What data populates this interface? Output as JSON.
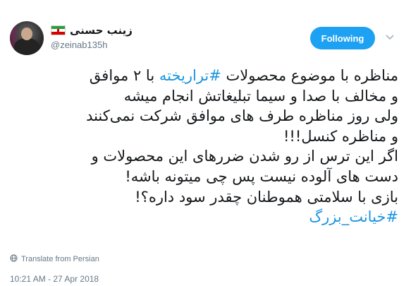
{
  "tweet": {
    "display_name": "زینب حسنی",
    "handle": "@zeinab135h",
    "follow_label": "Following",
    "lines": [
      {
        "parts": [
          {
            "text": "مناظره با موضوع محصولات ",
            "hashtag": false
          },
          {
            "text": "#تراریخته",
            "hashtag": true
          },
          {
            "text": " با ۲ موافق",
            "hashtag": false
          }
        ]
      },
      {
        "parts": [
          {
            "text": "و مخالف با صدا و سیما تبلیغاتش انجام میشه",
            "hashtag": false
          }
        ]
      },
      {
        "parts": [
          {
            "text": "ولی روز مناظره طرف های موافق شرکت نمی‌کنند",
            "hashtag": false
          }
        ]
      },
      {
        "parts": [
          {
            "text": "و مناظره کنسل!!!",
            "hashtag": false
          }
        ]
      },
      {
        "parts": [
          {
            "text": "اگر این ترس از رو شدن ضررهای این محصولات و",
            "hashtag": false
          }
        ]
      },
      {
        "parts": [
          {
            "text": "دست های آلوده نیست پس چی میتونه باشه!",
            "hashtag": false
          }
        ]
      },
      {
        "parts": [
          {
            "text": "بازی با سلامتی هموطنان چقدر سود داره؟!",
            "hashtag": false
          }
        ]
      },
      {
        "parts": [
          {
            "text": "#خیانت_بزرگ",
            "hashtag": true
          }
        ]
      }
    ],
    "translate_label": "Translate from Persian",
    "timestamp": "10:21 AM - 27 Apr 2018"
  },
  "colors": {
    "accent": "#1da1f2",
    "hashtag": "#1b95e0",
    "text": "#14171a",
    "muted": "#657786"
  },
  "icons": {
    "flag": "iran-flag-icon",
    "caret": "chevron-down-icon",
    "translate": "globe-icon"
  }
}
